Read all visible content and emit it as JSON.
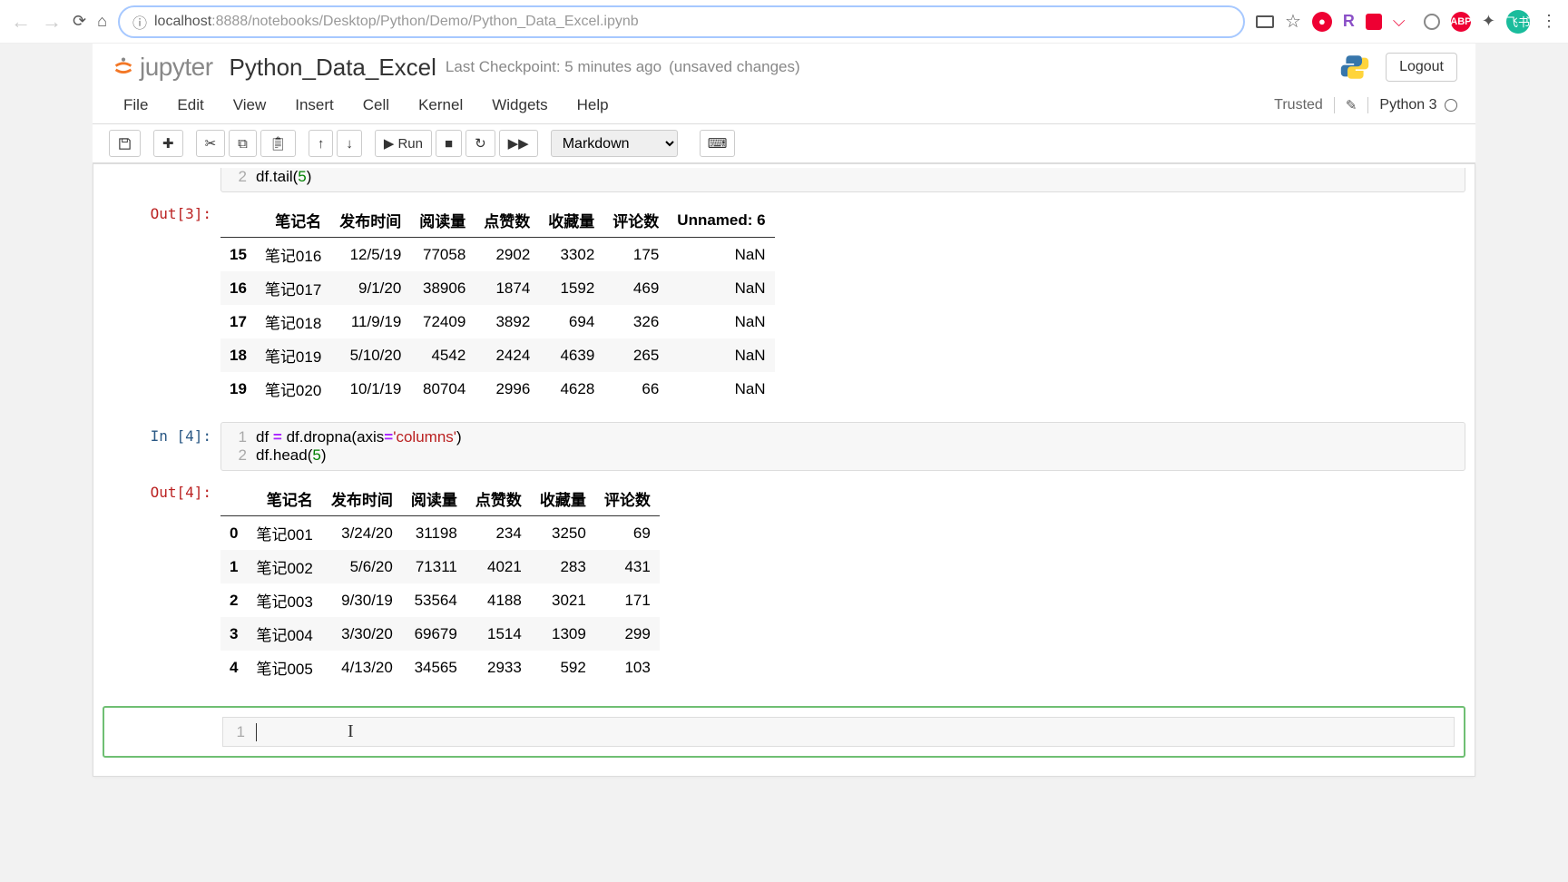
{
  "browser": {
    "url_host": "localhost",
    "url_port": ":8888",
    "url_path": "/notebooks/Desktop/Python/Demo/Python_Data_Excel.ipynb",
    "avatar_text": "飞书",
    "ext_r": "R",
    "ext_abp": "ABP"
  },
  "header": {
    "logo_text": "jupyter",
    "title": "Python_Data_Excel",
    "checkpoint": "Last Checkpoint: 5 minutes ago",
    "unsaved": "(unsaved changes)",
    "logout": "Logout"
  },
  "menubar": {
    "items": [
      "File",
      "Edit",
      "View",
      "Insert",
      "Cell",
      "Kernel",
      "Widgets",
      "Help"
    ],
    "trusted": "Trusted",
    "kernel": "Python 3"
  },
  "toolbar": {
    "run": "Run",
    "celltype": "Markdown"
  },
  "cell3": {
    "out_prompt": "Out[3]:",
    "code_line2": "df.tail(5)",
    "headers": [
      "笔记名",
      "发布时间",
      "阅读量",
      "点赞数",
      "收藏量",
      "评论数",
      "Unnamed: 6"
    ],
    "rows": [
      {
        "idx": "15",
        "c": [
          "笔记016",
          "12/5/19",
          "77058",
          "2902",
          "3302",
          "175",
          "NaN"
        ]
      },
      {
        "idx": "16",
        "c": [
          "笔记017",
          "9/1/20",
          "38906",
          "1874",
          "1592",
          "469",
          "NaN"
        ]
      },
      {
        "idx": "17",
        "c": [
          "笔记018",
          "11/9/19",
          "72409",
          "3892",
          "694",
          "326",
          "NaN"
        ]
      },
      {
        "idx": "18",
        "c": [
          "笔记019",
          "5/10/20",
          "4542",
          "2424",
          "4639",
          "265",
          "NaN"
        ]
      },
      {
        "idx": "19",
        "c": [
          "笔记020",
          "10/1/19",
          "80704",
          "2996",
          "4628",
          "66",
          "NaN"
        ]
      }
    ]
  },
  "cell4": {
    "in_prompt": "In [4]:",
    "out_prompt": "Out[4]:",
    "line1_a": "df ",
    "line1_b": "=",
    "line1_c": " df.dropna(axis",
    "line1_d": "=",
    "line1_e": "'columns'",
    "line1_f": ")",
    "line2_a": "df.head(",
    "line2_b": "5",
    "line2_c": ")",
    "headers": [
      "笔记名",
      "发布时间",
      "阅读量",
      "点赞数",
      "收藏量",
      "评论数"
    ],
    "rows": [
      {
        "idx": "0",
        "c": [
          "笔记001",
          "3/24/20",
          "31198",
          "234",
          "3250",
          "69"
        ]
      },
      {
        "idx": "1",
        "c": [
          "笔记002",
          "5/6/20",
          "71311",
          "4021",
          "283",
          "431"
        ]
      },
      {
        "idx": "2",
        "c": [
          "笔记003",
          "9/30/19",
          "53564",
          "4188",
          "3021",
          "171"
        ]
      },
      {
        "idx": "3",
        "c": [
          "笔记004",
          "3/30/20",
          "69679",
          "1514",
          "1309",
          "299"
        ]
      },
      {
        "idx": "4",
        "c": [
          "笔记005",
          "4/13/20",
          "34565",
          "2933",
          "592",
          "103"
        ]
      }
    ]
  },
  "empty": {
    "gutter": "1"
  }
}
